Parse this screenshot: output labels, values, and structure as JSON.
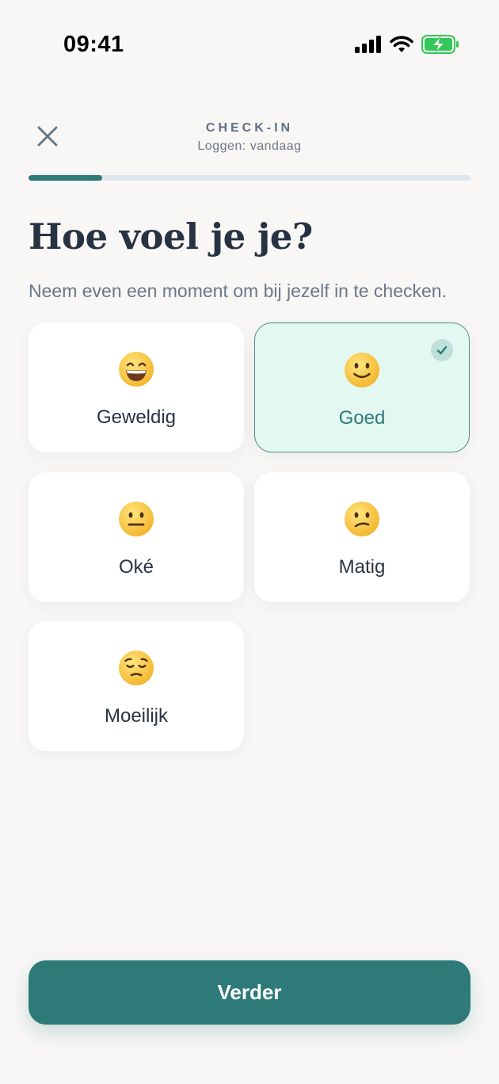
{
  "status_bar": {
    "time": "09:41",
    "icons": [
      "cellular-signal-icon",
      "wifi-icon",
      "battery-charging-icon"
    ]
  },
  "header": {
    "close_icon": "close-icon",
    "title": "CHECK-IN",
    "subtitle": "Loggen: vandaag"
  },
  "progress": {
    "value": 0.167
  },
  "question": {
    "title": "Hoe voel je je?",
    "subtitle": "Neem even een moment om bij jezelf in te checken."
  },
  "moods": [
    {
      "label": "Geweldig",
      "icon": "grinning-face-icon",
      "selected": false
    },
    {
      "label": "Goed",
      "icon": "slightly-smiling-face-icon",
      "selected": true
    },
    {
      "label": "Oké",
      "icon": "neutral-face-icon",
      "selected": false
    },
    {
      "label": "Matig",
      "icon": "confused-face-icon",
      "selected": false
    },
    {
      "label": "Moeilijk",
      "icon": "pensive-face-icon",
      "selected": false
    }
  ],
  "cta": {
    "label": "Verder"
  },
  "colors": {
    "accent": "#2D7A78",
    "background": "#F8F7F5",
    "selected_card": "#E4F8F2",
    "card": "#FFFFFF",
    "text_primary": "#273242",
    "text_secondary": "#6A788B"
  }
}
